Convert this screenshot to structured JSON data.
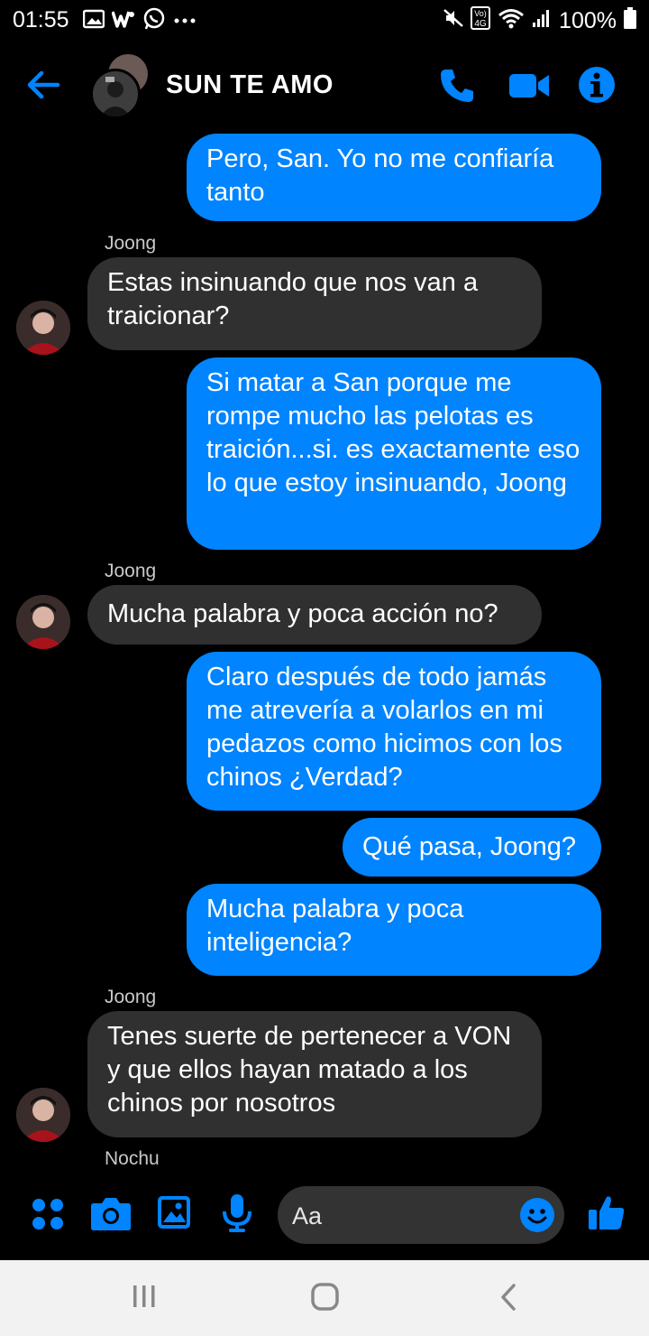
{
  "status_bar": {
    "time": "01:55",
    "battery": "100%",
    "left_icons": [
      "gallery-icon",
      "w-app-icon",
      "whatsapp-icon",
      "more-dots-icon"
    ],
    "right_icons": [
      "mute-icon",
      "volte-4g-icon",
      "wifi-icon",
      "signal-icon",
      "battery-icon"
    ],
    "network_label": "4G",
    "volte_label": "Vo)"
  },
  "header": {
    "contact_name": "SUN TE AMO",
    "icons": [
      "back-arrow-icon",
      "phone-icon",
      "video-icon",
      "info-icon"
    ],
    "accent_color": "#0084ff"
  },
  "messages": [
    {
      "dir": "out",
      "text": "Pero, San. Yo no me confiaría tanto"
    },
    {
      "dir": "in",
      "sender": "Joong",
      "text": "Estas insinuando que nos van a traicionar?"
    },
    {
      "dir": "out",
      "text": "Si matar a San porque me rompe mucho las pelotas es traición...si. es exactamente eso lo que estoy insinuando, Joong"
    },
    {
      "dir": "in",
      "sender": "Joong",
      "text": "Mucha palabra y poca acción no?"
    },
    {
      "dir": "out",
      "text": "Claro después de todo jamás me atrevería a volarlos en mi pedazos como hicimos con los chinos ¿Verdad?"
    },
    {
      "dir": "out",
      "text": "Qué pasa, Joong?"
    },
    {
      "dir": "out",
      "text": "Mucha palabra y poca inteligencia?"
    },
    {
      "dir": "in",
      "sender": "Joong",
      "text": "Tenes suerte de pertenecer a VON y que ellos hayan matado a los chinos por nosotros"
    }
  ],
  "typing_sender": "Nochu",
  "composer": {
    "placeholder": "Aa",
    "icons": [
      "apps-grid-icon",
      "camera-icon",
      "image-icon",
      "microphone-icon",
      "emoji-icon",
      "thumbs-up-icon"
    ]
  },
  "nav_bar": {
    "icons": [
      "recent-apps-icon",
      "home-icon",
      "back-icon"
    ]
  },
  "colors": {
    "outgoing_bubble": "#0084ff",
    "incoming_bubble": "#303030",
    "background": "#000000"
  }
}
